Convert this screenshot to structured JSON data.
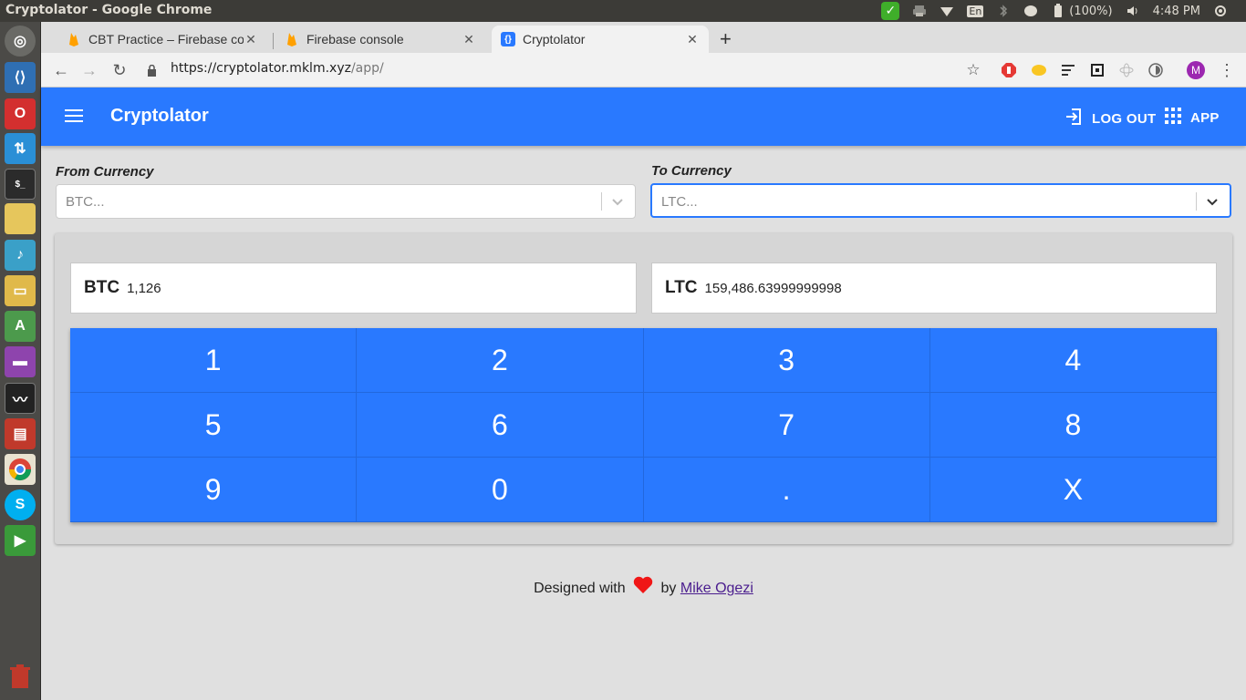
{
  "os": {
    "window_title": "Cryptolator - Google Chrome",
    "battery": "(100%)",
    "keyboard_layout": "En",
    "clock": "4:48 PM"
  },
  "browser": {
    "tabs": [
      {
        "title": "CBT Practice – Firebase co",
        "icon": "firebase-flame-icon"
      },
      {
        "title": "Firebase console",
        "icon": "firebase-flame-icon"
      },
      {
        "title": "Cryptolator",
        "icon": "braces-icon",
        "active": true
      }
    ],
    "url_host": "https://cryptolator.mklm.xyz",
    "url_path": "/app/",
    "profile_initial": "M"
  },
  "app": {
    "title": "Cryptolator",
    "logout_label": "LOG OUT",
    "app_label": "APP",
    "accent_color": "#2979ff"
  },
  "from": {
    "label": "From Currency",
    "value": "BTC...",
    "code": "BTC",
    "amount": "1,126"
  },
  "to": {
    "label": "To Currency",
    "value": "LTC...",
    "code": "LTC",
    "amount": "159,486.63999999998"
  },
  "keypad": [
    "1",
    "2",
    "3",
    "4",
    "5",
    "6",
    "7",
    "8",
    "9",
    "0",
    ".",
    "X"
  ],
  "footer": {
    "prefix": "Designed with",
    "by": "by",
    "author": "Mike Ogezi"
  }
}
